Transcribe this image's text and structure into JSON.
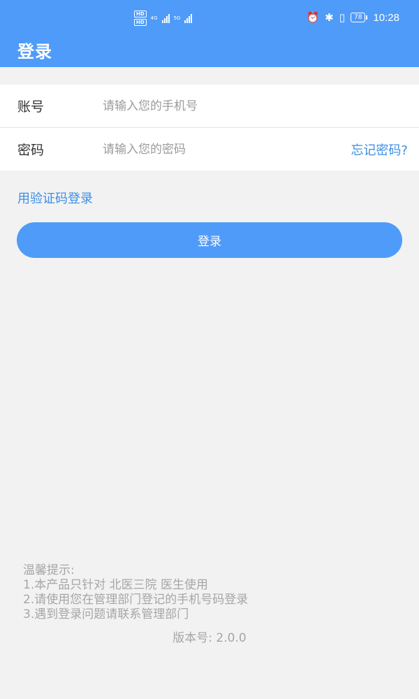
{
  "status_bar": {
    "hd1": "HD",
    "hd2": "HD",
    "net1": "4G",
    "net2": "5G",
    "battery": "78",
    "time": "10:28",
    "icons": [
      "alarm-icon",
      "bluetooth-icon",
      "vibrate-icon",
      "battery-icon",
      "signal-icon"
    ]
  },
  "header": {
    "title": "登录"
  },
  "form": {
    "account_label": "账号",
    "account_placeholder": "请输入您的手机号",
    "account_value": "",
    "password_label": "密码",
    "password_placeholder": "请输入您的密码",
    "password_value": "",
    "forgot_label": "忘记密码?"
  },
  "sms_login_label": "用验证码登录",
  "login_button_label": "登录",
  "tips": {
    "title": "温馨提示:",
    "lines": [
      "1.本产品只针对 北医三院 医生使用",
      "2.请使用您在管理部门登记的手机号码登录",
      "3.遇到登录问题请联系管理部门"
    ]
  },
  "version": "版本号: 2.0.0",
  "colors": {
    "primary": "#4f9bf9",
    "link": "#3d8ee6",
    "background": "#f2f2f2",
    "hint": "#a6a6a6"
  }
}
